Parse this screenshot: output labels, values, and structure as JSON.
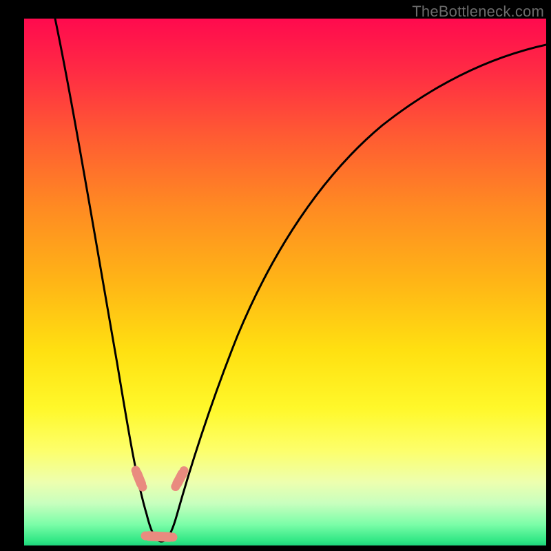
{
  "watermark": "TheBottleneck.com",
  "chart_data": {
    "type": "line",
    "title": "",
    "xlabel": "",
    "ylabel": "",
    "xlim": [
      0,
      100
    ],
    "ylim": [
      0,
      100
    ],
    "background_gradient": {
      "orientation": "vertical",
      "stops": [
        {
          "pos": 0.0,
          "color": "#ff0a4e"
        },
        {
          "pos": 0.1,
          "color": "#ff2b44"
        },
        {
          "pos": 0.22,
          "color": "#ff5a33"
        },
        {
          "pos": 0.36,
          "color": "#ff8b22"
        },
        {
          "pos": 0.5,
          "color": "#ffb516"
        },
        {
          "pos": 0.63,
          "color": "#ffe011"
        },
        {
          "pos": 0.74,
          "color": "#fff82a"
        },
        {
          "pos": 0.82,
          "color": "#fdff6b"
        },
        {
          "pos": 0.88,
          "color": "#edffaf"
        },
        {
          "pos": 0.92,
          "color": "#c8ffbe"
        },
        {
          "pos": 0.96,
          "color": "#7bfda8"
        },
        {
          "pos": 0.99,
          "color": "#33e886"
        },
        {
          "pos": 1.0,
          "color": "#1ed47c"
        }
      ]
    },
    "series": [
      {
        "name": "curve",
        "color": "#000000",
        "x": [
          6,
          8,
          10,
          12,
          14,
          16,
          18,
          20,
          22,
          23.5,
          25,
          27,
          29,
          32,
          36,
          40,
          45,
          50,
          55,
          60,
          66,
          74,
          82,
          90,
          100
        ],
        "y": [
          100,
          88,
          76,
          65,
          54,
          44,
          34,
          24,
          12,
          3,
          0,
          0,
          3,
          13,
          26,
          37,
          48,
          56,
          63,
          69,
          74,
          79,
          83,
          86,
          88
        ]
      }
    ],
    "markers": [
      {
        "name": "range-marker-left-top",
        "shape": "pill",
        "color": "#e98b7f",
        "x": 21.5,
        "y": 13,
        "angle": 68
      },
      {
        "name": "range-marker-right-top",
        "shape": "pill",
        "color": "#e98b7f",
        "x": 29.5,
        "y": 13,
        "angle": -62
      },
      {
        "name": "range-marker-bottom",
        "shape": "pill",
        "color": "#e98b7f",
        "x": 25.5,
        "y": 3,
        "angle": 3
      }
    ],
    "valley_x_estimate": 25,
    "notes": "No axis ticks, labels, legend, or title are visible. Values are pixel-estimated on a 0–100 normalized grid. y=100 corresponds to the top (red) of the gradient, y=0 to the bottom (green)."
  }
}
